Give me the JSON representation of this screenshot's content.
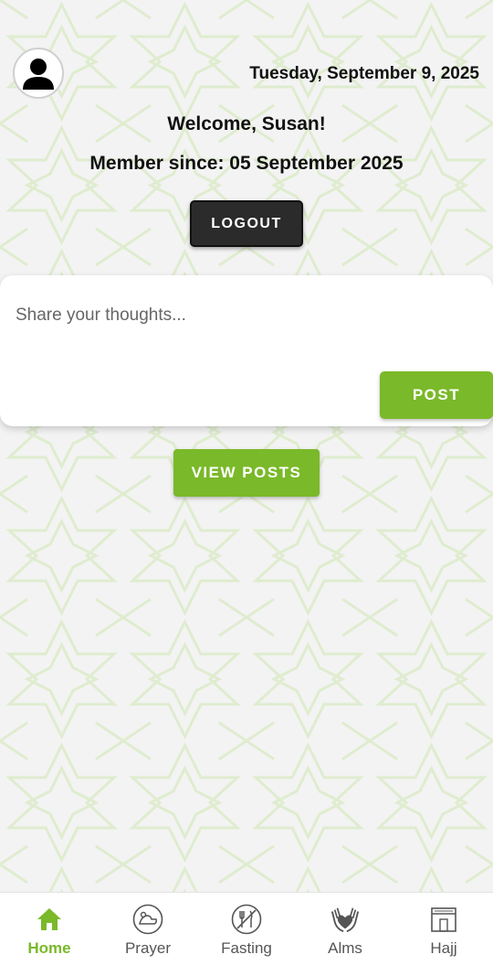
{
  "header": {
    "date": "Tuesday, September 9, 2025",
    "welcome": "Welcome, Susan!",
    "member_since": "Member since: 05 September 2025",
    "avatar_icon": "user-avatar-icon"
  },
  "actions": {
    "logout_label": "LOGOUT",
    "view_posts_label": "VIEW POSTS"
  },
  "composer": {
    "placeholder": "Share your thoughts...",
    "value": "",
    "post_label": "POST"
  },
  "nav": {
    "items": [
      {
        "label": "Home",
        "icon": "home-icon",
        "active": true
      },
      {
        "label": "Prayer",
        "icon": "prayer-icon",
        "active": false
      },
      {
        "label": "Fasting",
        "icon": "fasting-icon",
        "active": false
      },
      {
        "label": "Alms",
        "icon": "alms-icon",
        "active": false
      },
      {
        "label": "Hajj",
        "icon": "hajj-icon",
        "active": false
      }
    ]
  },
  "colors": {
    "accent": "#7ab929",
    "background": "#f3f3f3",
    "pattern": "#d9e8c8",
    "dark_button": "#2b2b2b"
  }
}
